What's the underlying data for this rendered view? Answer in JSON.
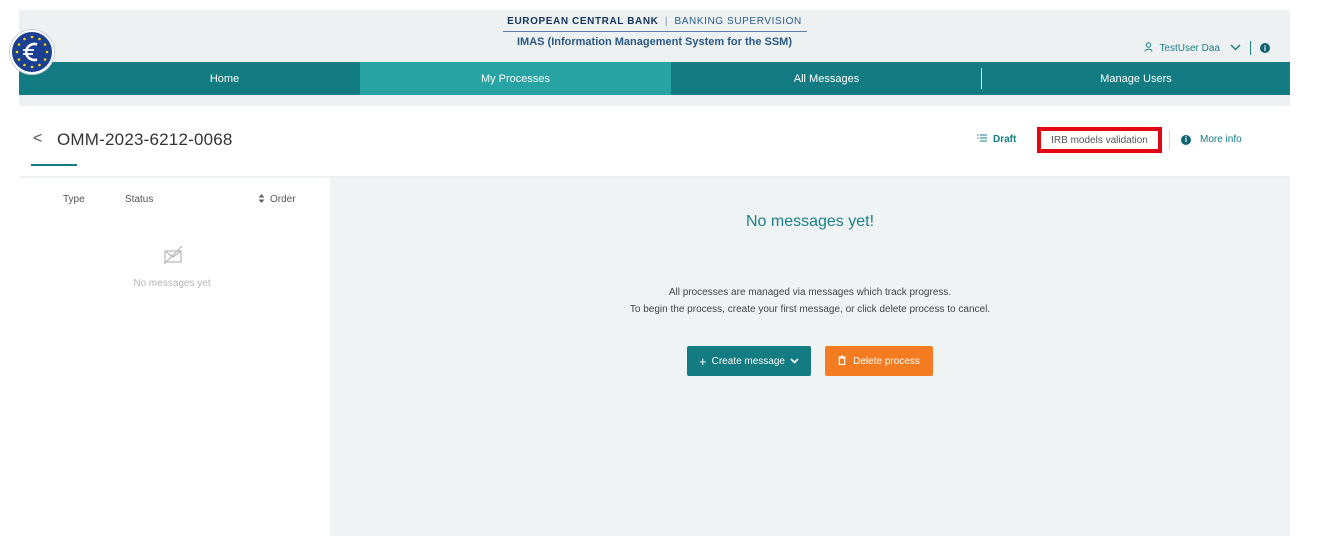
{
  "header": {
    "org_name": "EUROPEAN CENTRAL BANK",
    "org_separator": "|",
    "org_division": "BANKING SUPERVISION",
    "app_title": "IMAS (Information Management System for the SSM)",
    "user_name": "TestUser Daa"
  },
  "nav": {
    "items": [
      {
        "label": "Home",
        "active": false
      },
      {
        "label": "My Processes",
        "active": true
      },
      {
        "label": "All Messages",
        "active": false
      },
      {
        "label": "Manage Users",
        "active": false
      }
    ]
  },
  "process": {
    "back_symbol": "<",
    "id": "OMM-2023-6212-0068",
    "status": "Draft",
    "type_tag": "IRB models validation",
    "more_info_label": "More info"
  },
  "message_list": {
    "columns": {
      "type": "Type",
      "status": "Status",
      "order": "Order"
    },
    "empty_text": "No messages yet"
  },
  "main": {
    "title": "No messages yet!",
    "desc_line1": "All processes are managed via messages which track progress.",
    "desc_line2": "To begin the process, create your first message, or click delete process to cancel.",
    "create_button": "Create message",
    "delete_button": "Delete process"
  },
  "colors": {
    "primary_teal": "#137c82",
    "active_tab": "#27a3a3",
    "delete_orange": "#f47b20",
    "highlight_red": "#e30613"
  }
}
